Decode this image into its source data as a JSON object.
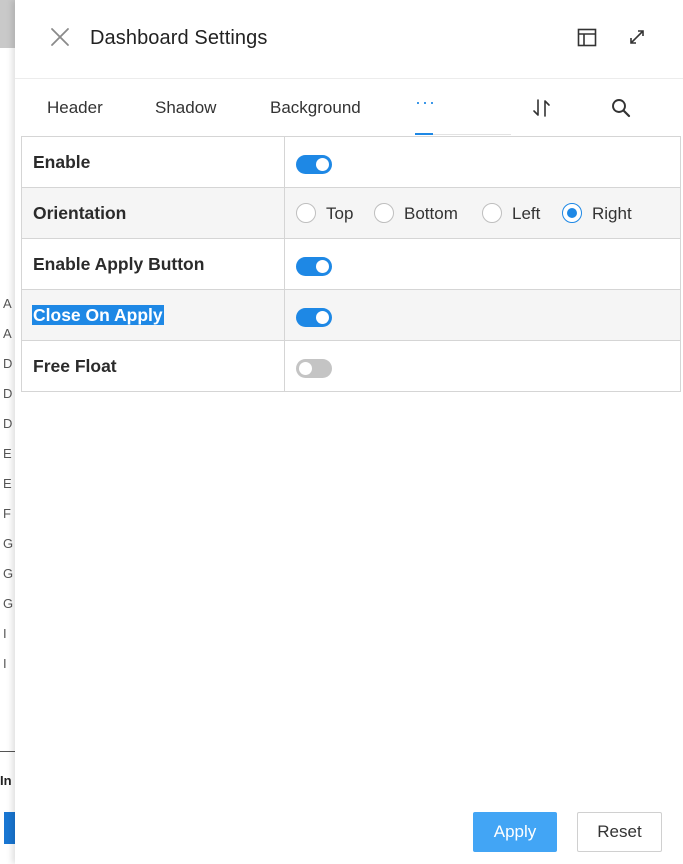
{
  "background_app": {
    "list_fragments": [
      "A",
      "A",
      "D",
      "D",
      "D",
      "E",
      "E",
      "F",
      "G",
      "G",
      "G",
      "I",
      "I"
    ],
    "footer_fragment": "In"
  },
  "panel": {
    "title": "Dashboard Settings",
    "icons": {
      "close": "close-icon",
      "layout": "layout-icon",
      "expand": "expand-icon"
    }
  },
  "tabs": {
    "items": [
      "Header",
      "Shadow",
      "Background"
    ],
    "more_label": "···",
    "active": "more",
    "icons": {
      "sort": "sort-icon",
      "search": "search-icon"
    }
  },
  "settings": {
    "enable": {
      "label": "Enable",
      "value": true
    },
    "orientation": {
      "label": "Orientation",
      "options": [
        "Top",
        "Bottom",
        "Left",
        "Right"
      ],
      "selected": "Right"
    },
    "enable_apply_button": {
      "label": "Enable Apply Button",
      "value": true
    },
    "close_on_apply": {
      "label": "Close On Apply",
      "value": true,
      "text_selected": true
    },
    "free_float": {
      "label": "Free Float",
      "value": false
    }
  },
  "footer": {
    "apply_label": "Apply",
    "reset_label": "Reset"
  },
  "colors": {
    "accent": "#1e88e5",
    "apply_button": "#42a5f5",
    "toggle_off": "#c4c4c4",
    "row_alt": "#f5f5f5"
  }
}
